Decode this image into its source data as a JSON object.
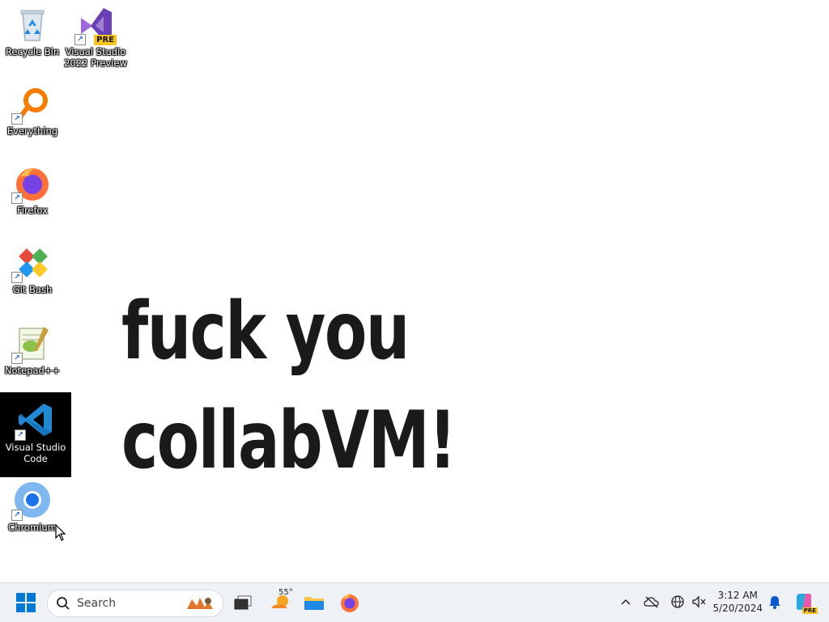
{
  "desktop": {
    "icons": [
      {
        "label": "Recycle Bin"
      },
      {
        "label": "Visual Studio 2022 Preview",
        "badge": "PRE"
      },
      {
        "label": "Everything"
      },
      {
        "label": "Firefox"
      },
      {
        "label": "Git Bash"
      },
      {
        "label": "Notepad++"
      },
      {
        "label": "Visual Studio Code"
      },
      {
        "label": "Chromium"
      }
    ],
    "wallpaper_lines": [
      "fuck you",
      "collabVM!"
    ]
  },
  "taskbar": {
    "search_label": "Search",
    "weather_temp": "55°",
    "clock_time": "3:12 AM",
    "clock_date": "5/20/2024",
    "copilot_badge": "PRE"
  },
  "colors": {
    "accent": "#0078d4",
    "taskbar_bg": "#eef1f6",
    "selected_icon_bg": "#000000"
  }
}
